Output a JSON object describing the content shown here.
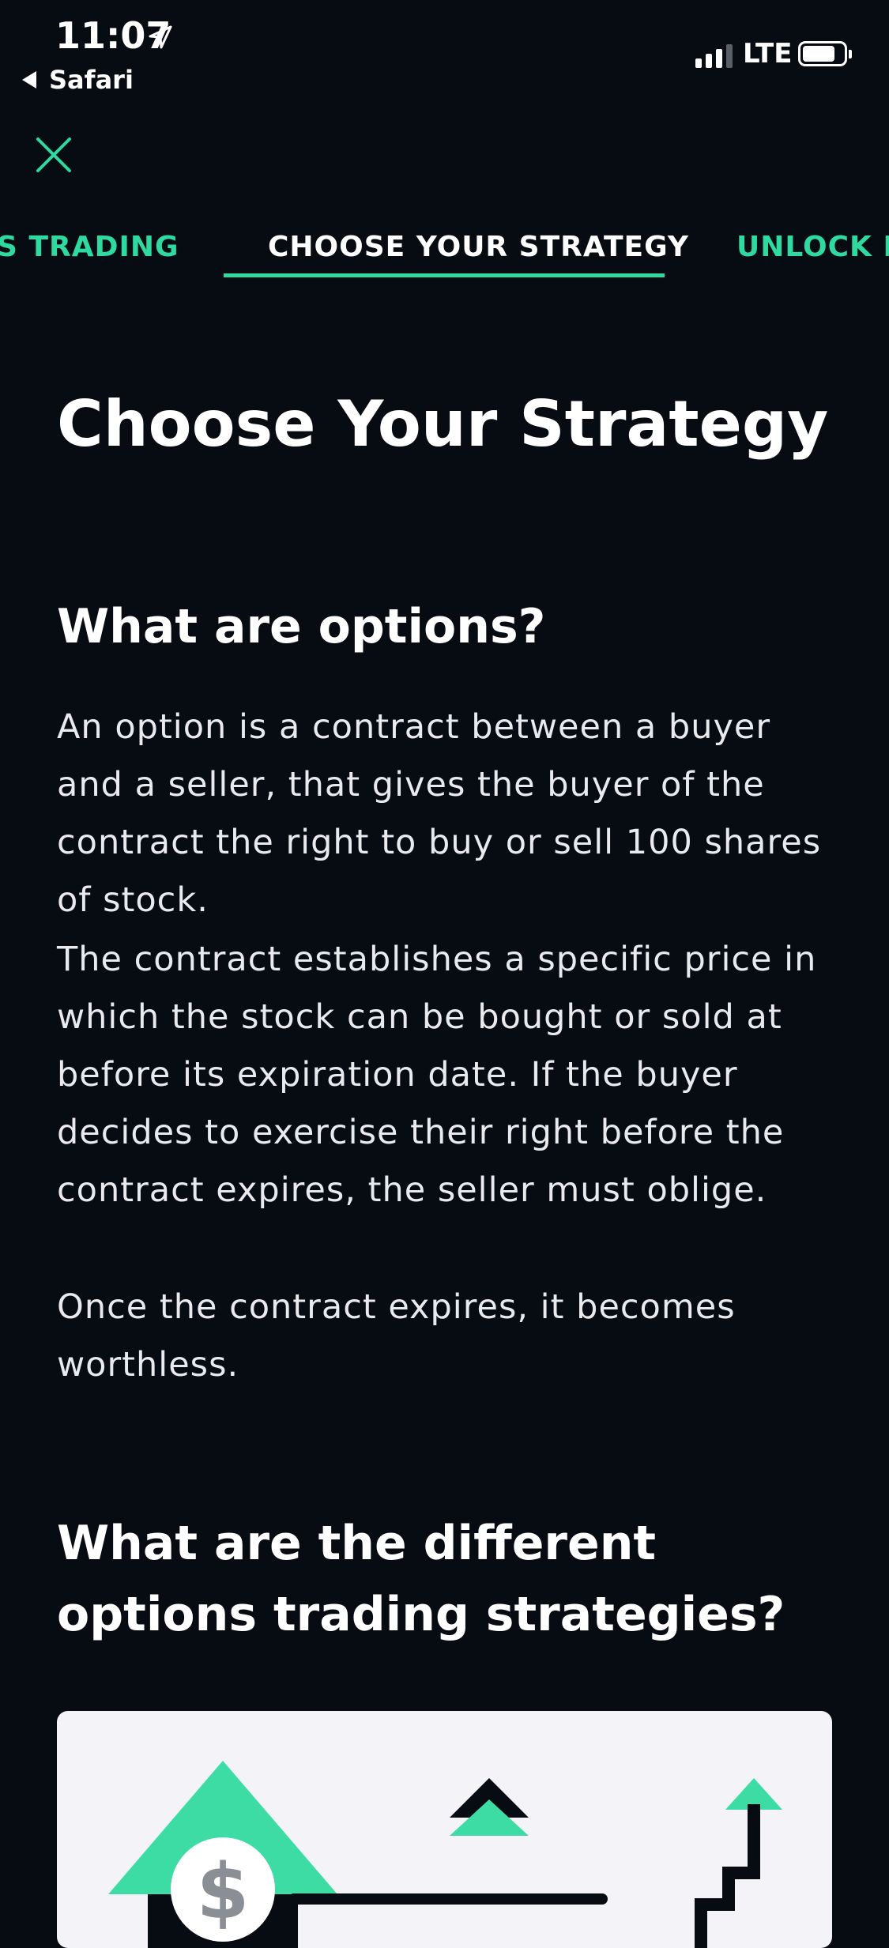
{
  "status_bar": {
    "time": "11:07",
    "back_label": "Safari",
    "network": "LTE",
    "icons": [
      "location-arrow-icon",
      "signal-icon",
      "battery-icon"
    ]
  },
  "nav": {
    "close_icon": "close-icon",
    "tabs": [
      {
        "label": "S TRADING",
        "active": false
      },
      {
        "label": "CHOOSE YOUR STRATEGY",
        "active": true
      },
      {
        "label": "UNLOCK M",
        "active": false
      }
    ]
  },
  "content": {
    "title": "Choose Your Strategy",
    "section1": {
      "heading": "What are options?",
      "paragraphs": [
        "An option is a contract between a buyer and a seller, that gives the buyer of the contract the right to buy or sell 100 shares of stock.",
        "The contract establishes a specific price in which the stock can be bought or sold at before its expiration date. If the buyer decides to exercise their right before the contract expires, the seller must oblige.",
        "Once the contract expires, it becomes worthless."
      ]
    },
    "section2": {
      "heading": "What are the different options trading strategies?"
    },
    "illustration": {
      "symbol": "$",
      "icons": [
        "bullish-arrow-icon",
        "neutral-arrows-icon",
        "staircase-arrow-icon"
      ]
    }
  },
  "colors": {
    "background": "#070b12",
    "accent": "#2fdaa0",
    "card": "#f4f4f8",
    "text": "#ffffff"
  }
}
